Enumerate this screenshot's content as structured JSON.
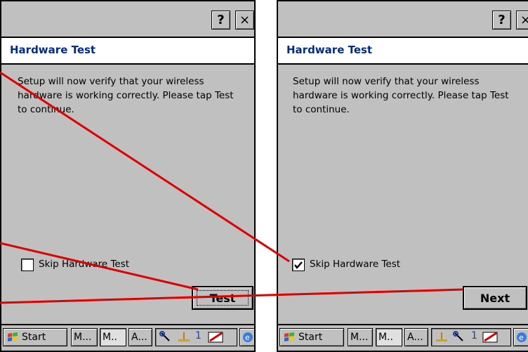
{
  "screens": [
    {
      "title_help": "?",
      "title_close": "×",
      "header": "Hardware Test",
      "message": "Setup will now verify that your wireless hardware is working correctly. Please tap Test to continue.",
      "checkbox_label": "Skip Hardware Test",
      "checkbox_checked": false,
      "action_label": "Test",
      "taskbar": {
        "start": "Start",
        "task1": "M...",
        "task2": "M..",
        "task3": "A...",
        "tray_number": "1"
      }
    },
    {
      "title_help": "?",
      "title_close": "×",
      "header": "Hardware Test",
      "message": "Setup will now verify that your wireless hardware is working correctly. Please tap Test to continue.",
      "checkbox_label": "Skip Hardware Test",
      "checkbox_checked": true,
      "action_label": "Next",
      "taskbar": {
        "start": "Start",
        "task1": "M...",
        "task2": "M..",
        "task3": "A...",
        "tray_number": "1"
      }
    }
  ],
  "colors": {
    "header_text": "#002c8c",
    "panel_bg": "#c0c0c0",
    "annotation_line": "#e00000"
  },
  "icons": [
    "help-icon",
    "close-icon",
    "windows-flag-icon",
    "settings-icon",
    "network-icon",
    "battery-icon",
    "internet-explorer-icon",
    "checkmark-icon"
  ]
}
